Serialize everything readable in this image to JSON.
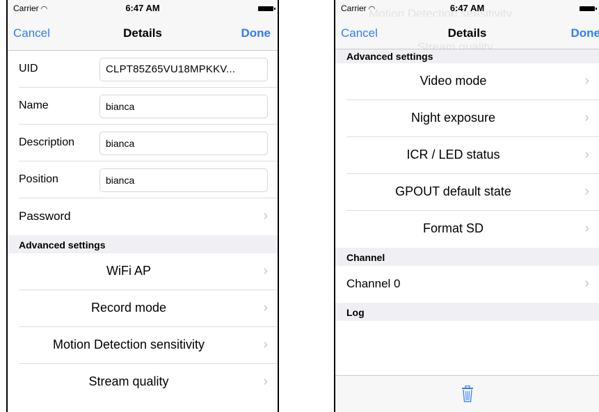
{
  "status": {
    "carrier": "Carrier",
    "time": "6:47 AM"
  },
  "nav": {
    "cancel": "Cancel",
    "title": "Details",
    "done": "Done"
  },
  "left": {
    "fields": [
      {
        "label": "UID",
        "value": "CLPT85Z65VU18MPKKV..."
      },
      {
        "label": "Name",
        "value": "bianca"
      },
      {
        "label": "Description",
        "value": "bianca"
      },
      {
        "label": "Position",
        "value": "bianca"
      }
    ],
    "password": "Password",
    "section_advanced": "Advanced settings",
    "advanced_items": [
      "WiFi AP",
      "Record mode",
      "Motion Detection sensitivity",
      "Stream quality"
    ]
  },
  "right": {
    "ghost_text": [
      "Motion Detection sensitivity",
      "Stream quality"
    ],
    "section_advanced": "Advanced settings",
    "advanced_items": [
      "Video mode",
      "Night exposure",
      "ICR / LED status",
      "GPOUT default state",
      "Format SD"
    ],
    "section_channel": "Channel",
    "channel_item": "Channel 0",
    "section_log": "Log"
  },
  "icons": {
    "chevron": "chevron-right-icon",
    "trash": "trash-icon",
    "wifi": "wifi-icon",
    "battery": "battery-icon"
  },
  "colors": {
    "accent": "#2f7df6",
    "section_bg": "#efeff4",
    "bar_bg": "#f7f7f7"
  }
}
